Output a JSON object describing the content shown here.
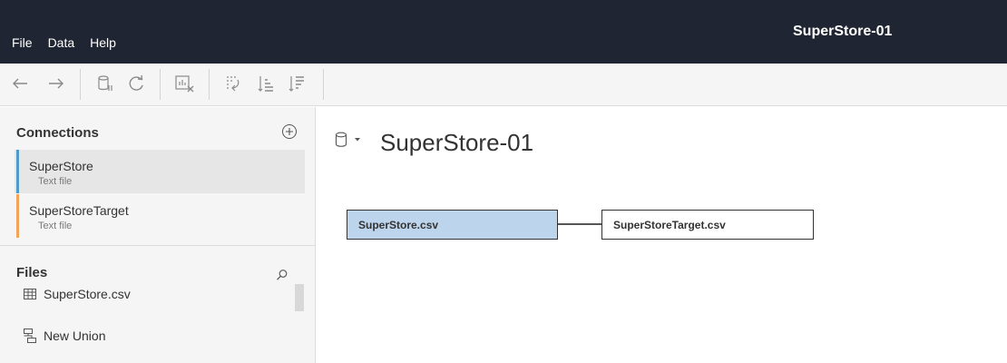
{
  "menu": {
    "items": [
      "File",
      "Data",
      "Help"
    ]
  },
  "app": {
    "title": "SuperStore-01"
  },
  "toolbar": {
    "buttons": [
      "back-arrow-icon",
      "forward-arrow-icon",
      "pause-update-icon",
      "refresh-icon",
      "clear-sheet-icon",
      "swap-icon",
      "sort-ascending-icon",
      "sort-descending-icon"
    ]
  },
  "sidebar": {
    "connections_title": "Connections",
    "connections": [
      {
        "name": "SuperStore",
        "type": "Text file",
        "color": "#4e9ac8"
      },
      {
        "name": "SuperStoreTarget",
        "type": "Text file",
        "color": "#f2a45a"
      }
    ],
    "files_title": "Files",
    "files": [
      {
        "name": "SuperStore.csv"
      }
    ],
    "new_union_label": "New Union"
  },
  "canvas": {
    "datasource_title": "SuperStore-01",
    "tables": [
      {
        "name": "SuperStore.csv",
        "selected": true
      },
      {
        "name": "SuperStoreTarget.csv",
        "selected": false
      }
    ]
  },
  "colors": {
    "menubar_bg": "#1f2532",
    "selected_table_bg": "#bcd4ec"
  }
}
